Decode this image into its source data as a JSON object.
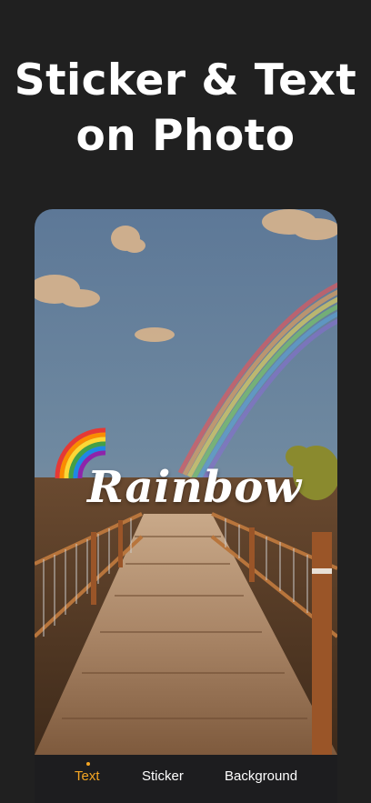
{
  "promo": {
    "headline_line1": "Sticker & Text",
    "headline_line2": "on Photo"
  },
  "editor": {
    "overlay_text": "Rainbow",
    "sticker_icon": "rainbow-sticker-icon"
  },
  "tabs": [
    {
      "label": "Text",
      "active": true
    },
    {
      "label": "Sticker",
      "active": false
    },
    {
      "label": "Background",
      "active": false
    }
  ],
  "colors": {
    "background": "#202020",
    "accent": "#f5a623",
    "tab_bar": "#1d1d1f"
  }
}
